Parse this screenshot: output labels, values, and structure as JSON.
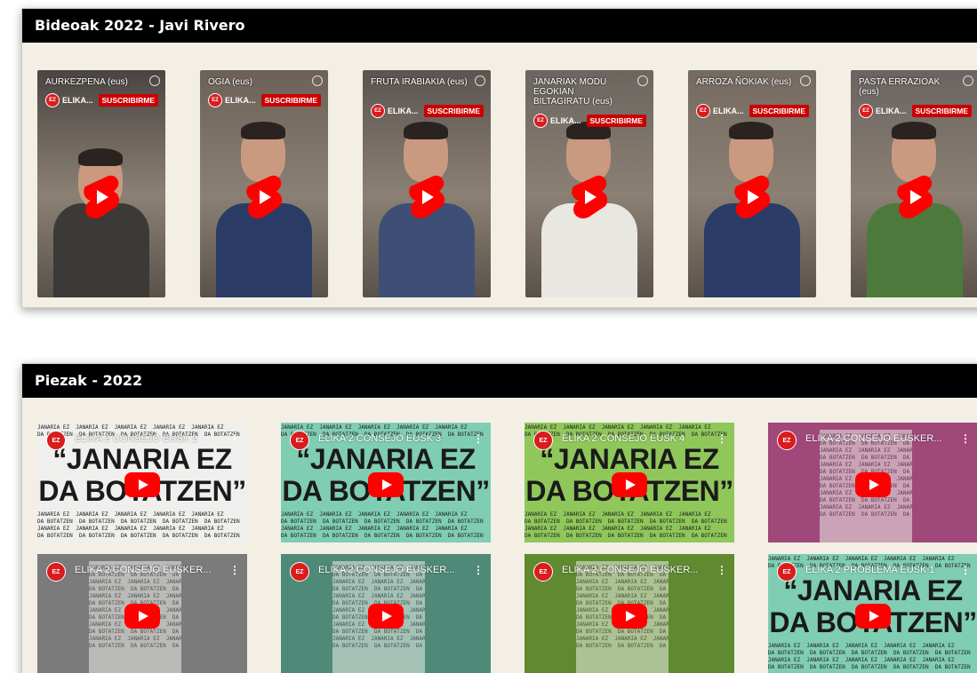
{
  "panels": [
    {
      "title": "Bideoak 2022 - Javi Rivero"
    },
    {
      "title": "Piezak - 2022"
    }
  ],
  "shorts": [
    {
      "title": "AURKEZPENA (eus)",
      "channel": "ELIKA...",
      "subscribe": "SUSCRIBIRME",
      "scene": "#4a4542"
    },
    {
      "title": "OGIA (eus)",
      "channel": "ELIKA...",
      "subscribe": "SUSCRIBIRME",
      "scene": "#6c6158"
    },
    {
      "title": "FRUTA IRABIAKIA (eus)",
      "channel": "ELIKA...",
      "subscribe": "SUSCRIBIRME",
      "scene": "#5b5450"
    },
    {
      "title": "JANARIAK MODU EGOKIAN BILTAGIRATU (eus)",
      "channel": "ELIKA...",
      "subscribe": "SUSCRIBIRME",
      "scene": "#6b6660"
    },
    {
      "title": "ARROZA ÑOKIAK (eus)",
      "channel": "ELIKA...",
      "subscribe": "SUSCRIBIRME",
      "scene": "#746a60"
    },
    {
      "title": "PASTA ERRAZIOAK (eus)",
      "channel": "ELIKA...",
      "subscribe": "SUSCRIBIRME",
      "scene": "#6a6460"
    }
  ],
  "pieces": [
    {
      "title": "ELIKA 2 CONSEJO EUSK 2",
      "bg": "#efefed",
      "big": [
        "“JANARIA EZ",
        "DA BOTATZEN”"
      ]
    },
    {
      "title": "ELIKA 2 CONSEJO EUSK 3",
      "bg": "#7fcdb3",
      "big": [
        "“JANARIA EZ",
        "DA BOTATZEN”"
      ]
    },
    {
      "title": "ELIKA 2 CONSEJO EUSK 4",
      "bg": "#8fc75a",
      "big": [
        "“JANARIA EZ",
        "DA BOTATZEN”"
      ]
    },
    {
      "title": "ELIKA 2 CONSEJO EUSKER...",
      "bg": "#a0487a",
      "big": []
    },
    {
      "title": "ELIKA 2 CONSEJO EUSKER...",
      "bg": "#7b7b7b",
      "big": []
    },
    {
      "title": "ELIKA 2 CONSEJO EUSKER...",
      "bg": "#4f8a78",
      "big": []
    },
    {
      "title": "ELIKA 2 CONSEJO EUSKER...",
      "bg": "#5f8a30",
      "big": []
    },
    {
      "title": "ELIKA 2 PROBLEMA EUSK 1",
      "bg": "#7fcdb3",
      "big": [
        "“JANARIA EZ",
        "DA BOTATZEN”"
      ]
    }
  ],
  "strip_text": "JANARIA EZ  JANARIA EZ  JANARIA EZ  JANARIA EZ  JANARIA EZ\nDA BOTATZEN  DA BOTATZEN  DA BOTATZEN  DA BOTATZEN  DA BOTATZEN",
  "logo_text": "EZ"
}
